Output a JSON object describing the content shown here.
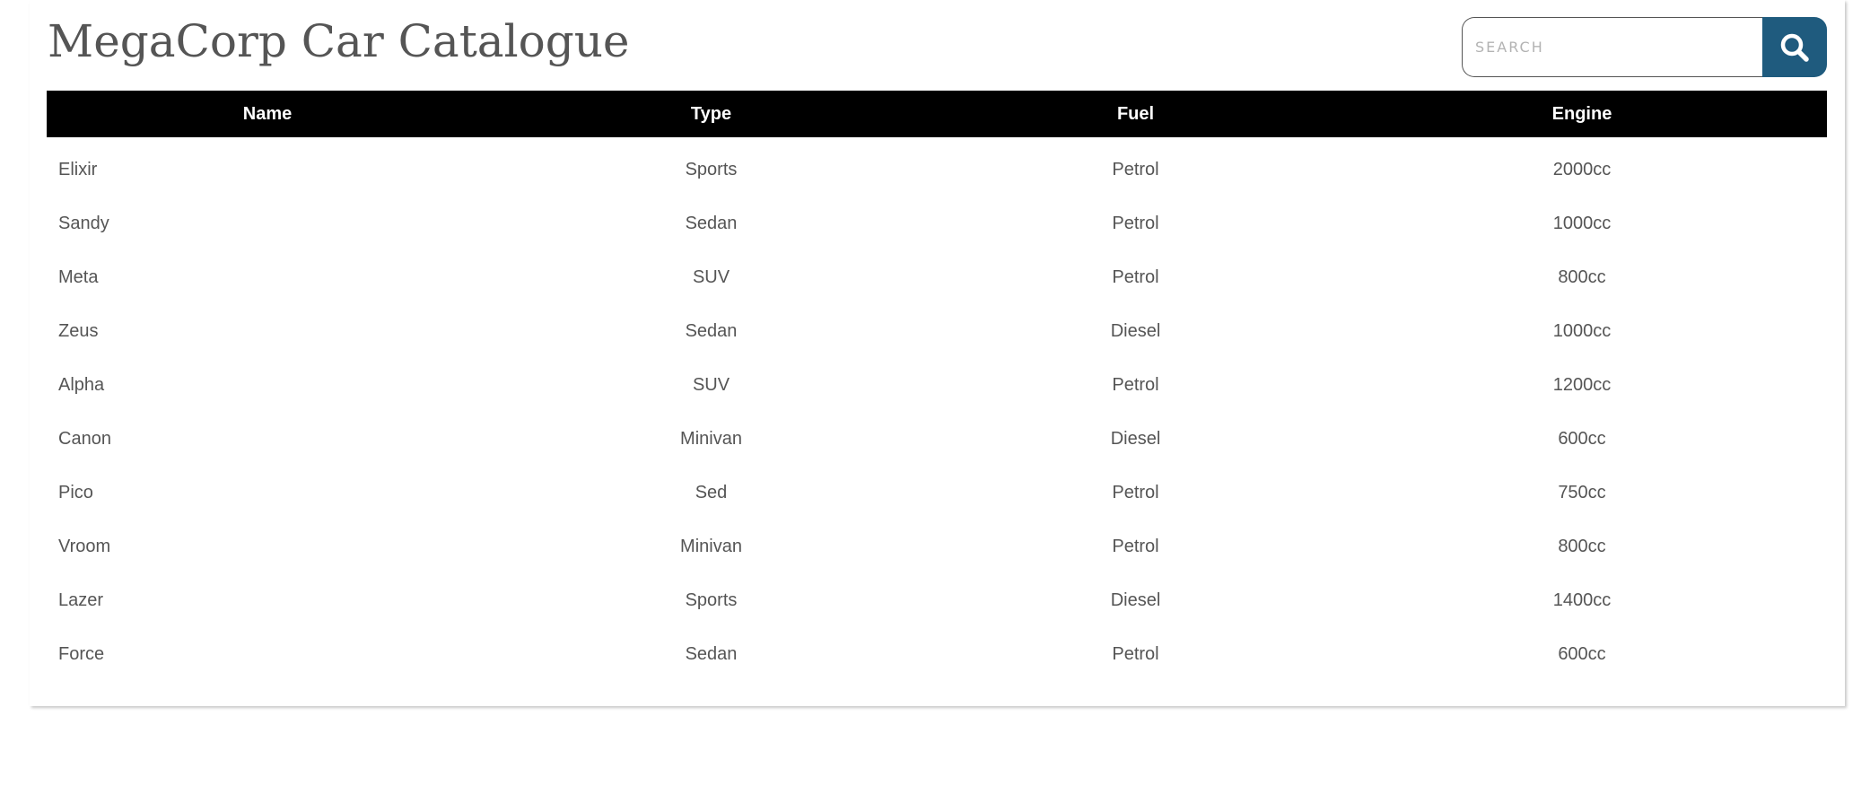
{
  "header": {
    "title": "MegaCorp Car Catalogue"
  },
  "search": {
    "placeholder": "SEARCH",
    "value": "",
    "button_icon": "search-icon",
    "button_color": "#1f5b7e"
  },
  "table": {
    "columns": [
      "Name",
      "Type",
      "Fuel",
      "Engine"
    ],
    "header_background": "#000000",
    "header_text_color": "#ffffff",
    "rows": [
      [
        "Elixir",
        "Sports",
        "Petrol",
        "2000cc"
      ],
      [
        "Sandy",
        "Sedan",
        "Petrol",
        "1000cc"
      ],
      [
        "Meta",
        "SUV",
        "Petrol",
        "800cc"
      ],
      [
        "Zeus",
        "Sedan",
        "Diesel",
        "1000cc"
      ],
      [
        "Alpha",
        "SUV",
        "Petrol",
        "1200cc"
      ],
      [
        "Canon",
        "Minivan",
        "Diesel",
        "600cc"
      ],
      [
        "Pico",
        "Sed",
        "Petrol",
        "750cc"
      ],
      [
        "Vroom",
        "Minivan",
        "Petrol",
        "800cc"
      ],
      [
        "Lazer",
        "Sports",
        "Diesel",
        "1400cc"
      ],
      [
        "Force",
        "Sedan",
        "Petrol",
        "600cc"
      ]
    ]
  }
}
